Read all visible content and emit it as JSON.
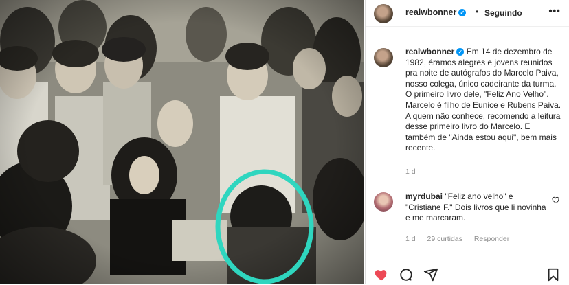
{
  "post": {
    "username": "realwbonner",
    "follow_status": "Seguindo",
    "caption": "Em 14 de dezembro de 1982, éramos alegres e jovens reunidos pra noite de autógrafos do Marcelo Paiva, nosso colega, único cadeirante da turma. O primeiro livro dele, \"Feliz Ano Velho\". Marcelo é filho de Eunice e Rubens Paiva. A quem não conhece, recomendo a leitura desse primeiro livro do Marcelo. E também de \"Ainda estou aqui\", bem mais recente.",
    "caption_time": "1 d"
  },
  "comment": {
    "username": "myrdubai",
    "text": "\"Feliz ano velho\" e \"Cristiane F.\" Dois livros que li novinha e me marcaram.",
    "time": "1 d",
    "likes": "29 curtidas",
    "reply_label": "Responder"
  },
  "icons": {
    "verified": "verified-badge-icon",
    "more": "more-options-icon",
    "heart_filled": "heart-filled-icon",
    "comment": "comment-icon",
    "share": "share-icon",
    "save": "bookmark-icon"
  },
  "colors": {
    "highlight_circle": "#2fd6bf",
    "like_red": "#ed4956",
    "verified_blue": "#0095f6"
  }
}
